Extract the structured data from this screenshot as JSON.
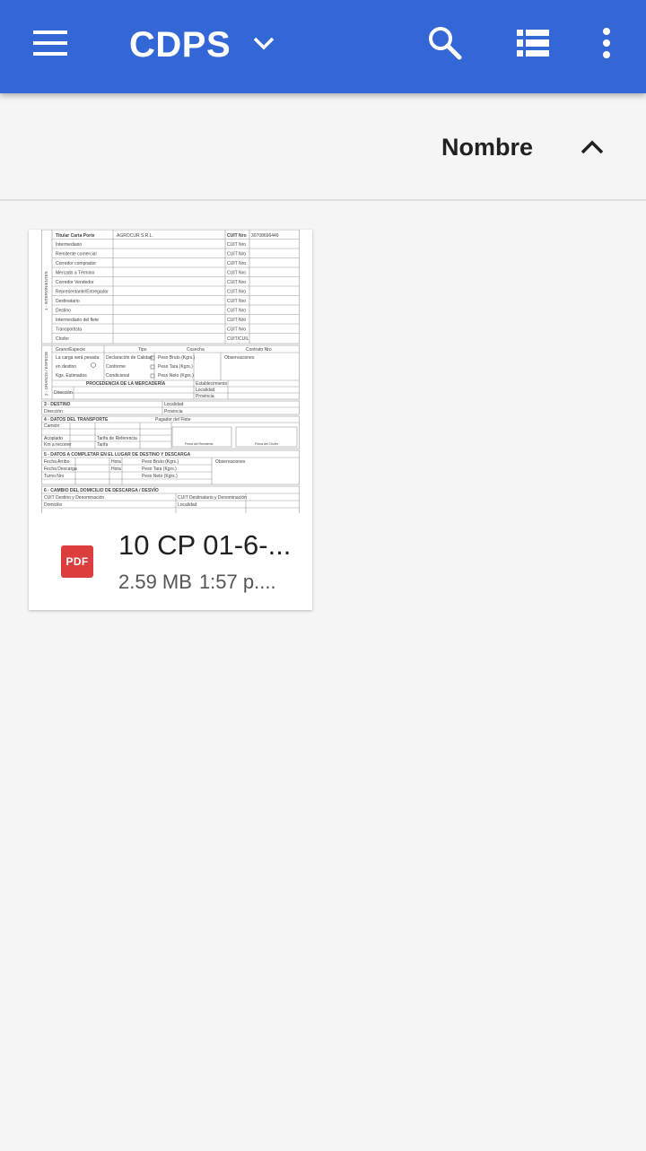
{
  "app_bar": {
    "title": "CDPS",
    "icons": {
      "menu": "menu-icon",
      "dropdown": "chevron-down-icon",
      "search": "search-icon",
      "view": "list-view-icon",
      "more": "more-vert-icon"
    },
    "color": "#3367d6"
  },
  "sort_bar": {
    "label": "Nombre",
    "direction_icon": "chevron-up-icon"
  },
  "files": [
    {
      "name": "10 CP 01-6-...",
      "size": "2.59 MB",
      "modified": "1:57 p....",
      "type_badge": "PDF",
      "badge_color": "#dc3e3e",
      "thumbnail_text": {
        "titular": "Titular Carta Porte",
        "titular_value": "AGROCUR S.R.L.",
        "cuit_label": "CUIT Nro",
        "cuit_value": "30708696449",
        "cuit_cuil": "CUIT/CUIL",
        "roles": [
          "Intermediario",
          "Remitente comercial",
          "Corredor comprador",
          "Mercado a Término",
          "Corredor Vendedor",
          "Representante/Entregador",
          "Destinatario",
          "Destino",
          "Intermediario del flete",
          "Transportista",
          "Chofer"
        ],
        "section1": "1 - INTERVINIENTES",
        "section2": "2 - GRANOS / ESPECIE",
        "grano_especie": "Grano/Especie",
        "tipo": "Tipo",
        "cosecha": "Cosecha",
        "contrato": "Contrato Nro",
        "carga_pesada": "La carga será pesada",
        "en_destino": "en destino",
        "kgs_estimados": "Kgs. Estimados",
        "declaracion": "Declaración de Calidad",
        "conforme": "Conforme",
        "condicional": "Condicional",
        "peso_bruto": "Peso Bruto (Kgrs.)",
        "peso_tara": "Peso Tara (Kgrs.)",
        "peso_neto": "Peso Neto (Kgrs.)",
        "observaciones": "Observaciones",
        "procedencia": "PROCEDENCIA DE LA MERCADERÍA",
        "establecimiento": "Establecimiento",
        "localidad": "Localidad",
        "provincia": "Provincia",
        "direccion": "Dirección",
        "section3": "3 - DESTINO",
        "section4": "4 - DATOS DEL TRANSPORTE",
        "pagador": "Pagador del Flete",
        "camion": "Camión",
        "acoplado": "Acoplado",
        "km_recorrer": "Km a recorrer",
        "tarifa_ref": "Tarifa de Referencia",
        "tarifa": "Tarifa",
        "firma_remitente": "Firma del Remitente",
        "firma_chofer": "Firma del Chofer",
        "section5": "5 - DATOS A COMPLETAR EN EL LUGAR DE DESTINO Y DESCARGA",
        "fecha_arribo": "Fecha Arribo",
        "fecha_descarga": "Fecha Descarga",
        "turno": "Turno Nro",
        "hora": "Hora",
        "section6": "6 - CAMBIO DEL DOMICILIO DE DESCARGA / DESVÍO",
        "cuit_destino": "CUIT Destino y Denominación",
        "cuit_destinatario": "CUIT Destinatario y Denominación",
        "domicilio": "Domicilio"
      }
    }
  ]
}
